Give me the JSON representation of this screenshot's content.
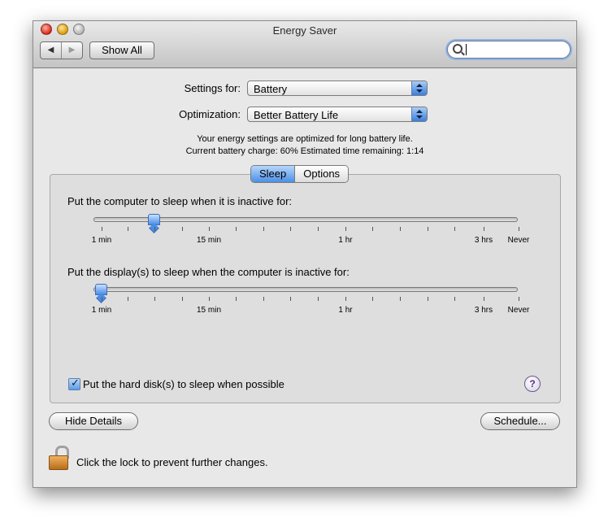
{
  "window": {
    "title": "Energy Saver",
    "show_all_label": "Show All",
    "nav_back": "◀",
    "nav_forward": "▶",
    "search": {
      "value": "",
      "placeholder": ""
    }
  },
  "settings": {
    "settings_for_label": "Settings for:",
    "settings_for_value": "Battery",
    "optimization_label": "Optimization:",
    "optimization_value": "Better Battery Life",
    "info_line1": "Your energy settings are optimized for long battery life.",
    "info_line2": "Current battery charge: 60%  Estimated time remaining: 1:14"
  },
  "tabs": [
    {
      "label": "Sleep",
      "selected": true
    },
    {
      "label": "Options",
      "selected": false
    }
  ],
  "computer_sleep": {
    "label": "Put the computer to sleep when it is inactive for:",
    "value_fraction": 0.14
  },
  "display_sleep": {
    "label": "Put the display(s) to sleep when the computer is inactive for:",
    "value_fraction": 0.015
  },
  "scale_labels": [
    "1 min",
    "15 min",
    "1 hr",
    "3 hrs",
    "Never"
  ],
  "hard_disk": {
    "label": "Put the hard disk(s) to sleep when possible",
    "checked": true
  },
  "help_label": "?",
  "buttons": {
    "hide_details": "Hide Details",
    "schedule": "Schedule..."
  },
  "lock_text": "Click the lock to prevent further changes.",
  "colors": {
    "selection_blue": "#4b8fe6",
    "window_bg": "#e8e8e8"
  }
}
